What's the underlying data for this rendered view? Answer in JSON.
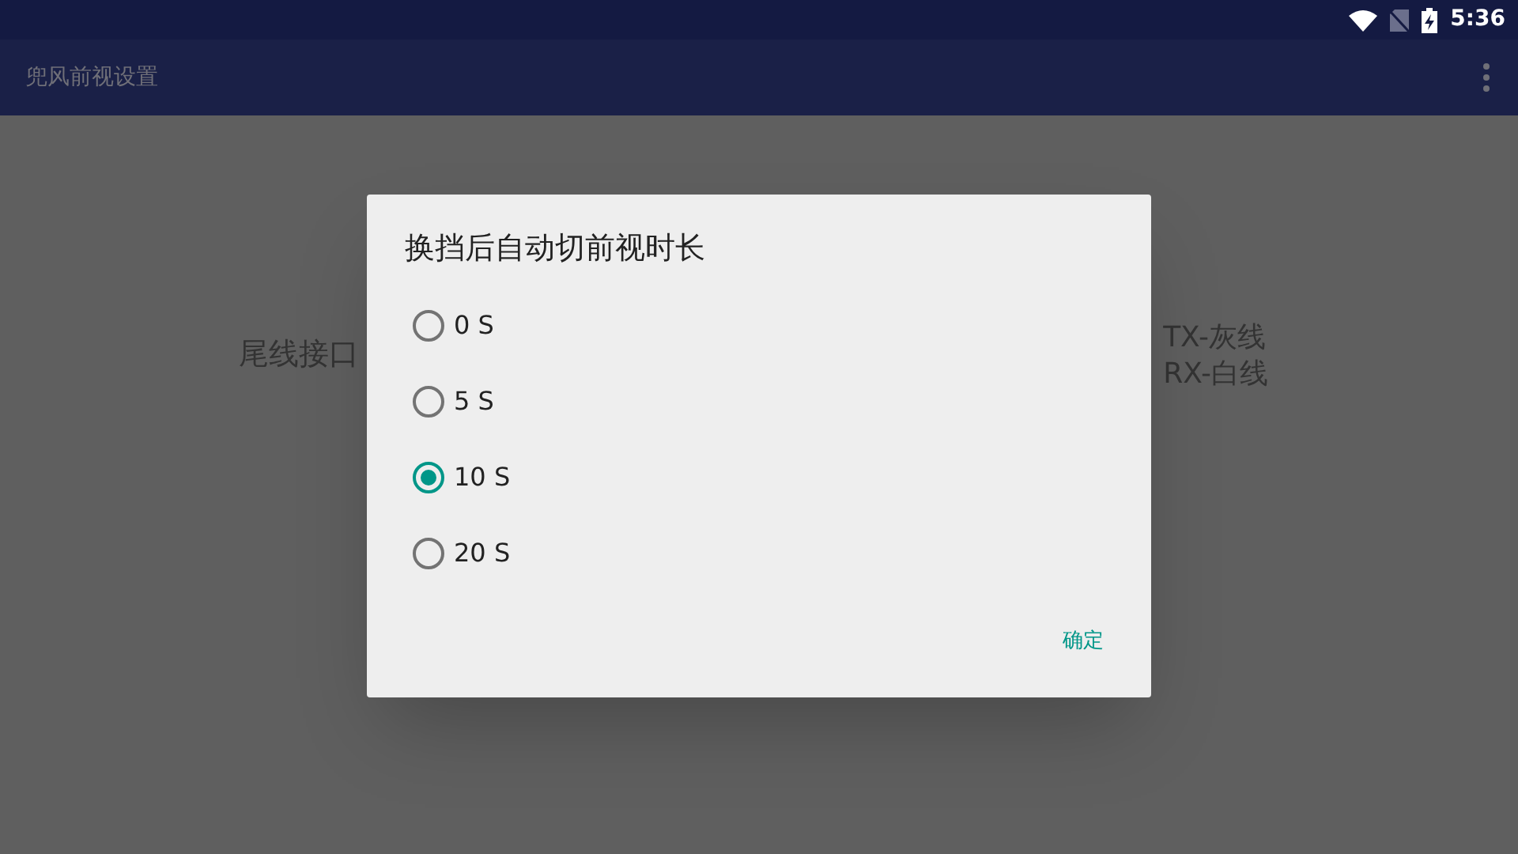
{
  "status_bar": {
    "time": "5:36"
  },
  "app_bar": {
    "title": "兜风前视设置"
  },
  "background": {
    "left_label": "尾线接口",
    "right_lines": [
      "TX-灰线",
      "RX-白线"
    ]
  },
  "dialog": {
    "title": "换挡后自动切前视时长",
    "options": [
      {
        "label": "0 S",
        "selected": false
      },
      {
        "label": "5 S",
        "selected": false
      },
      {
        "label": "10 S",
        "selected": true
      },
      {
        "label": "20 S",
        "selected": false
      }
    ],
    "confirm": "确定"
  }
}
